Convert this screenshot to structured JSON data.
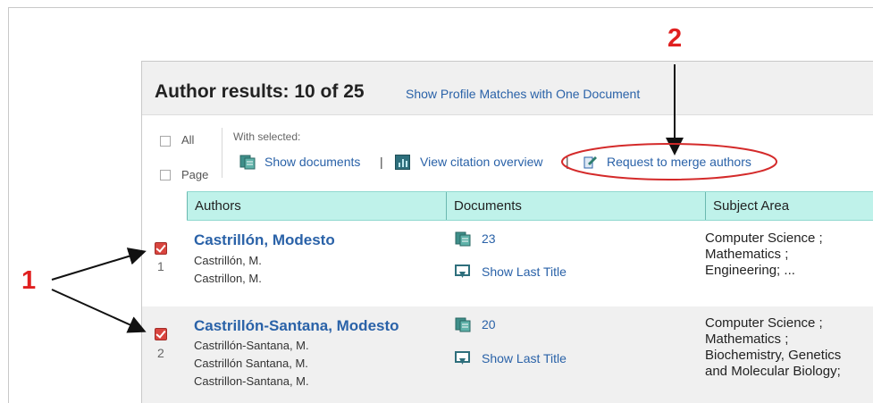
{
  "annotations": {
    "one": "1",
    "two": "2"
  },
  "results": {
    "label": "Author results:",
    "count": "10 of 25",
    "profile_link": "Show Profile Matches with One Document"
  },
  "selection": {
    "all_label": "All",
    "page_label": "Page",
    "with_selected": "With selected:"
  },
  "actions": {
    "show_documents": "Show documents",
    "view_citation": "View citation overview",
    "request_merge": "Request to merge authors",
    "separator": "|"
  },
  "table": {
    "headers": [
      "Authors",
      "Documents",
      "Subject Area"
    ],
    "rows": [
      {
        "number": "1",
        "name": "Castrillón, Modesto",
        "variants": [
          "Castrillón, M.",
          "Castrillon, M."
        ],
        "documents": "23",
        "last_title": "Show Last Title",
        "subjects": [
          "Computer Science ;",
          "Mathematics ;",
          "Engineering; ..."
        ],
        "checked": true
      },
      {
        "number": "2",
        "name": "Castrillón-Santana, Modesto",
        "variants": [
          "Castrillón-Santana, M.",
          "Castrillón Santana, M.",
          "Castrillon-Santana, M."
        ],
        "documents": "20",
        "last_title": "Show Last Title",
        "subjects": [
          "Computer Science ;",
          "Mathematics ;",
          "Biochemistry, Genetics",
          "and Molecular Biology;"
        ],
        "checked": true
      }
    ]
  },
  "colors": {
    "link": "#2a62a8",
    "header_bg": "#bff2ea",
    "annotation": "#e02020",
    "checkbox": "#d9453f"
  },
  "icons": [
    "documents-icon",
    "citation-chart-icon",
    "merge-authors-icon",
    "show-last-title-icon"
  ]
}
